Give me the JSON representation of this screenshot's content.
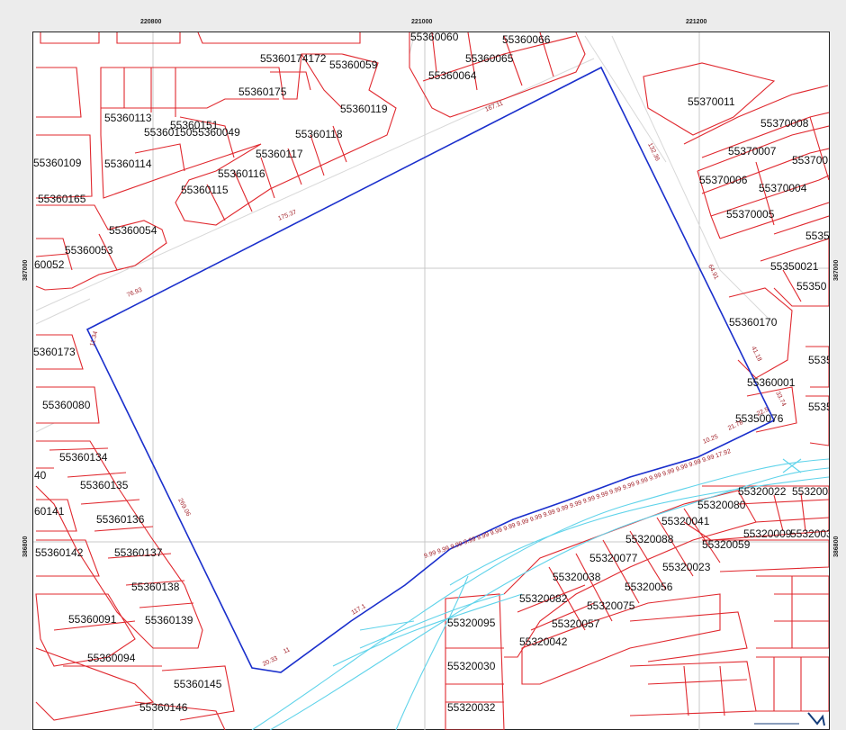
{
  "grid": {
    "top_x": [
      "220800",
      "221000",
      "221200"
    ],
    "bottom_x": [
      "220800",
      "221000",
      "221200"
    ],
    "left_y": [
      "387000",
      "386800"
    ],
    "right_y": [
      "387000",
      "386800"
    ]
  },
  "parcels": {
    "p55360060": "55360060",
    "p55360066": "55360066",
    "p55360065": "55360065",
    "p55360064": "55360064",
    "p55360172": "55360174172",
    "p55360059": "55360059",
    "p55360175": "55360175",
    "p55360119": "55360119",
    "p55360113": "55360113",
    "p55360151": "55360151",
    "p55360150": "5536015055360049",
    "p55360118": "55360118",
    "p55360117": "55360117",
    "p55360109": "55360109",
    "p55360114": "55360114",
    "p55360116": "55360116",
    "p55360115": "55360115",
    "p55360165": "55360165",
    "p55360054": "55360054",
    "p55360053": "55360053",
    "p55360052": "60052",
    "p55360173": "5360173",
    "p55360080": "55360080",
    "p55360134": "55360134",
    "p55360135": "55360135",
    "p55360141": "60141",
    "p55360136": "55360136",
    "p55360142": "55360142",
    "p55360137": "55360137",
    "p55360138": "55360138",
    "p55360091": "55360091",
    "p55360139": "55360139",
    "p55360094": "55360094",
    "p55360145": "55360145",
    "p55360146": "55360146",
    "p55370011": "55370011",
    "p55370008": "55370008",
    "p55370007": "55370007",
    "p55370000": "553700",
    "p55370006": "55370006",
    "p55370004": "55370004",
    "p55370005": "55370005",
    "p55350021": "55350021",
    "p55350": "55350",
    "p5535": "5535",
    "p55360170": "55360170",
    "p55360001": "55360001",
    "p55350076": "55350076",
    "p5535r1": "5535",
    "p5535r2": "5535",
    "p55320022": "55320022",
    "p55320023b": "5532003",
    "p55320080": "55320080",
    "p55320041": "55320041",
    "p55320088": "55320088",
    "p55320009": "55320009",
    "p55320009b": "5532003",
    "p55320059": "55320059",
    "p55320077": "55320077",
    "p55320023": "55320023",
    "p55320038": "55320038",
    "p55320056": "55320056",
    "p55320082": "55320082",
    "p55320075": "55320075",
    "p55320095": "55320095",
    "p55320057": "55320057",
    "p55320042": "55320042",
    "p55320030": "55320030",
    "p55320032": "55320032",
    "p40": "40"
  },
  "dimensions": {
    "d167": "167.11",
    "d132": "132.36",
    "d175": "175.37",
    "d76": "76.93",
    "d11": "11.34",
    "d64": "64.91",
    "d41": "41.18",
    "d33": "33.74",
    "d22": "22.5",
    "d21": "21.78",
    "d10": "10.25",
    "d269": "269.06",
    "d117": "117.1",
    "d20": "20.33",
    "d11b": "11",
    "dseq": "9.99 9.99 9.99 9.99 9.99 9.99 9.99 9.99 9.99 9.99 9.99 9.99 9.99 9.99 9.99 9.99 9.99 9.99 9.99 9.99 9.99 9.99 17.92"
  },
  "colors": {
    "parcel_line": "#e0282e",
    "boundary": "#1a2fcc",
    "road": "#5fd3ea",
    "grid": "#c8c8c8",
    "road_edge": "#d8d8d8"
  },
  "logo": {
    "text": "..."
  }
}
